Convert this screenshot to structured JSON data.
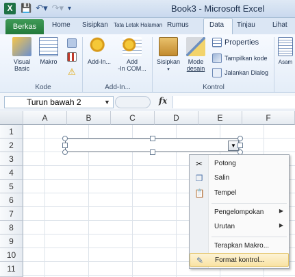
{
  "window": {
    "title": "Book3 - Microsoft Excel",
    "app_icon": "X"
  },
  "qat": {
    "save_icon": "save-icon",
    "undo_icon": "undo-icon",
    "redo_icon": "redo-icon"
  },
  "tabs": {
    "file": "Berkas",
    "items": [
      "Home",
      "Sisipkan",
      "Tata Letak Halaman",
      "Rumus",
      "Data",
      "Tinjau",
      "Lihat"
    ]
  },
  "ribbon": {
    "groups": {
      "kode": {
        "label": "Kode",
        "visual_basic_line1": "Visual",
        "visual_basic_line2": "Basic",
        "makro": "Makro"
      },
      "addin": {
        "label": "Add-In...",
        "addins": "Add-In...",
        "com_line1": "Add",
        "com_line2": "-In COM..."
      },
      "kontrol": {
        "label": "Kontrol",
        "sisipkan": "Sisipkan",
        "mode_line1": "Mode",
        "mode_line2": "desain",
        "properties": "Properties",
        "tampilkan_kode": "Tampilkan kode",
        "jalankan_dialog": "Jalankan Dialog"
      },
      "xml": {
        "asam": "Asam"
      }
    }
  },
  "formula_bar": {
    "name_box": "Turun bawah 2",
    "fx": "fx"
  },
  "grid": {
    "columns": [
      "A",
      "B",
      "C",
      "D",
      "E",
      "F"
    ],
    "rows": [
      "1",
      "2",
      "3",
      "4",
      "5",
      "6",
      "7",
      "8",
      "9",
      "10",
      "11"
    ]
  },
  "context_menu": {
    "items": [
      {
        "label": "Potong",
        "icon": "scissors-icon"
      },
      {
        "label": "Salin",
        "icon": "copy-icon"
      },
      {
        "label": "Tempel",
        "icon": "paste-icon"
      },
      {
        "label": "Pengelompokan",
        "submenu": true
      },
      {
        "label": "Urutan",
        "submenu": true
      },
      {
        "label": "Terapkan Makro..."
      },
      {
        "label": "Format kontrol...",
        "icon": "format-control-icon",
        "highlighted": true
      }
    ]
  }
}
